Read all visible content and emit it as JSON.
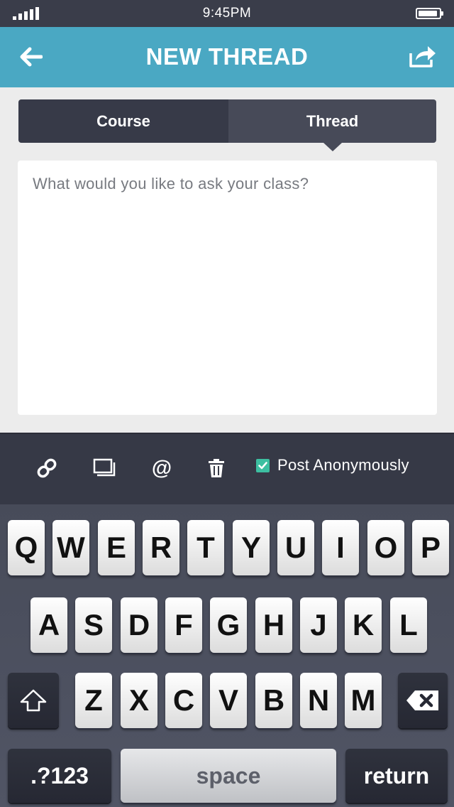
{
  "status_bar": {
    "time": "9:45PM",
    "signal_icon": "signal-bars-icon",
    "battery_icon": "battery-full-icon"
  },
  "nav": {
    "title": "NEW THREAD",
    "back_icon": "back-arrow-icon",
    "share_icon": "share-icon",
    "color": "#4aa8c3"
  },
  "tabs": [
    {
      "label": "Course",
      "selected": false
    },
    {
      "label": "Thread",
      "selected": true
    }
  ],
  "compose": {
    "placeholder": "What would you like to ask your class?",
    "value": ""
  },
  "toolbar": {
    "link_icon": "link-icon",
    "image_icon": "image-stack-icon",
    "mention_icon": "at-mention-icon",
    "trash_icon": "trash-icon",
    "anonymous": {
      "label": "Post Anonymously",
      "checked": true,
      "color": "#3dbfa1"
    }
  },
  "keyboard": {
    "rows": [
      [
        "Q",
        "W",
        "E",
        "R",
        "T",
        "Y",
        "U",
        "I",
        "O",
        "P"
      ],
      [
        "A",
        "S",
        "D",
        "F",
        "G",
        "H",
        "J",
        "K",
        "L"
      ],
      [
        "Z",
        "X",
        "C",
        "V",
        "B",
        "N",
        "M"
      ]
    ],
    "shift_icon": "shift-arrow-icon",
    "delete_icon": "backspace-icon",
    "numbers_label": ".?123",
    "space_label": "space",
    "return_label": "return"
  }
}
